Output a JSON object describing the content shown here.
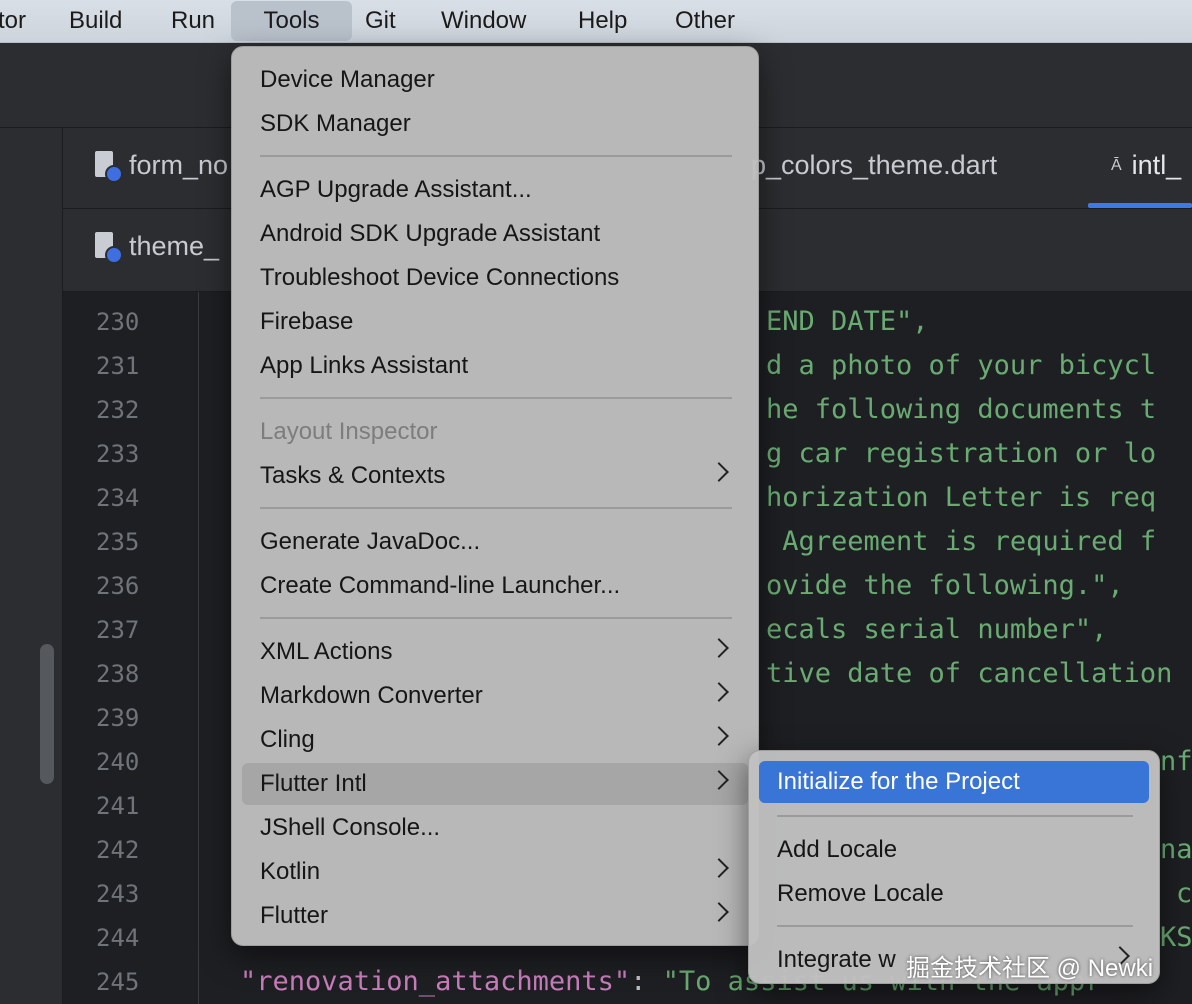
{
  "menubar": {
    "items": [
      "tor",
      "Build",
      "Run",
      "Tools",
      "Git",
      "Window",
      "Help",
      "Other"
    ],
    "active": "Tools"
  },
  "tabs": {
    "row1": [
      "form_no",
      "p_colors_theme.dart",
      "intl_"
    ],
    "row2": [
      "theme_"
    ]
  },
  "editor": {
    "line_numbers": [
      "230",
      "231",
      "232",
      "233",
      "234",
      "235",
      "236",
      "237",
      "238",
      "239",
      "240",
      "241",
      "242",
      "243",
      "244",
      "245"
    ],
    "fragments": {
      "l230": "END DATE\",",
      "l231": "d a photo of your bicycl",
      "l232": "he following documents t",
      "l233": "g car registration or lo",
      "l234": "horization Letter is req",
      "l235": " Agreement is required f",
      "l236": "ovide the following.\",",
      "l237": "ecals serial number\",",
      "l238": "tive date of cancellation",
      "l240": "nf",
      "l242": "na",
      "l243": "c",
      "l244": "KS",
      "l245_key": "\"renovation_attachments\"",
      "l245_colon": ": ",
      "l245_value": "\"To assist us with the appr"
    }
  },
  "tools_menu": {
    "device_manager": "Device Manager",
    "sdk_manager": "SDK Manager",
    "agp_upgrade": "AGP Upgrade Assistant...",
    "android_sdk_upgrade": "Android SDK Upgrade Assistant",
    "troubleshoot": "Troubleshoot Device Connections",
    "firebase": "Firebase",
    "app_links": "App Links Assistant",
    "layout_inspector": "Layout Inspector",
    "tasks_contexts": "Tasks & Contexts",
    "generate_javadoc": "Generate JavaDoc...",
    "command_line_launcher": "Create Command-line Launcher...",
    "xml_actions": "XML Actions",
    "markdown_converter": "Markdown Converter",
    "cling": "Cling",
    "flutter_intl": "Flutter Intl",
    "jshell": "JShell Console...",
    "kotlin": "Kotlin",
    "flutter": "Flutter"
  },
  "flutter_intl_submenu": {
    "initialize": "Initialize for the Project",
    "add_locale": "Add Locale",
    "remove_locale": "Remove Locale",
    "integrate": "Integrate w"
  },
  "watermark": "掘金技术社区 @ Newki",
  "colors": {
    "selection": "#3875d7",
    "string": "#6aab73",
    "key": "#c77dbb"
  }
}
